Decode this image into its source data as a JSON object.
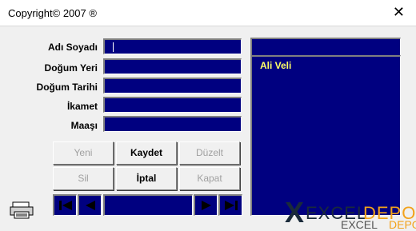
{
  "window": {
    "title": "Copyright© 2007 ®",
    "close_glyph": "✕"
  },
  "form": {
    "fields": [
      {
        "label": "Adı Soyadı",
        "value": ""
      },
      {
        "label": "Doğum Yeri",
        "value": ""
      },
      {
        "label": "Doğum Tarihi",
        "value": ""
      },
      {
        "label": "İkamet",
        "value": ""
      },
      {
        "label": "Maaşı",
        "value": ""
      }
    ]
  },
  "list": {
    "items": [
      "Ali Veli"
    ]
  },
  "buttons": {
    "row1": [
      {
        "label": "Yeni",
        "enabled": false
      },
      {
        "label": "Kaydet",
        "enabled": true
      },
      {
        "label": "Düzelt",
        "enabled": false
      }
    ],
    "row2": [
      {
        "label": "Sil",
        "enabled": false
      },
      {
        "label": "İptal",
        "enabled": true
      },
      {
        "label": "Kapat",
        "enabled": false
      }
    ]
  },
  "navigation": {
    "first_icon": "first-record-icon",
    "prev_icon": "previous-record-icon",
    "next_icon": "next-record-icon",
    "last_icon": "last-record-icon",
    "record_value": ""
  },
  "logo": {
    "mark": "X",
    "word1": "EXCEL",
    "word2": "DEPO",
    "shadow1": "EXCEL",
    "shadow2": "DEPO"
  },
  "colors": {
    "field_bg": "#000080",
    "list_text": "#ffff66",
    "logo_accent": "#f2a21b"
  },
  "icons": {
    "print": "printer-icon"
  }
}
